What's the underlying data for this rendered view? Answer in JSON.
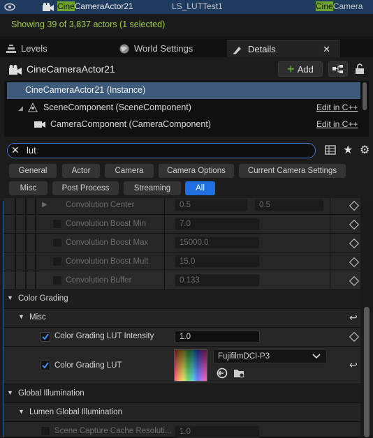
{
  "outliner": {
    "highlight": "Cine",
    "actor_suffix": "CameraActor21",
    "level": "LS_LUTTest1",
    "type_highlight": "Cine",
    "type_suffix": "Camera",
    "status": "Showing 39 of 3,837 actors (1 selected)"
  },
  "tabs": {
    "levels": "Levels",
    "world_settings": "World Settings",
    "details": "Details"
  },
  "details": {
    "title": "CineCameraActor21",
    "add_label": "Add",
    "components": [
      {
        "label": "CineCameraActor21 (Instance)",
        "edit": ""
      },
      {
        "label": "SceneComponent (SceneComponent)",
        "edit": "Edit in C++"
      },
      {
        "label": "CameraComponent (CameraComponent)",
        "edit": "Edit in C++"
      }
    ],
    "search_value": "lut",
    "filters": [
      "General",
      "Actor",
      "Camera",
      "Camera Options",
      "Current Camera Settings",
      "Misc",
      "Post Process",
      "Streaming",
      "All"
    ]
  },
  "properties": {
    "conv_center": {
      "label": "Convolution Center",
      "x": "0.5",
      "y": "0.5"
    },
    "conv_boost_min": {
      "label": "Convolution Boost Min",
      "value": "7.0"
    },
    "conv_boost_max": {
      "label": "Convolution Boost Max",
      "value": "15000.0"
    },
    "conv_boost_mult": {
      "label": "Convolution Boost Mult",
      "value": "15.0"
    },
    "conv_buffer": {
      "label": "Convolution Buffer",
      "value": "0.133"
    },
    "color_grading": "Color Grading",
    "misc": "Misc",
    "lut_intensity": {
      "label": "Color Grading LUT Intensity",
      "value": "1.0"
    },
    "lut": {
      "label": "Color Grading LUT",
      "asset": "FujifilmDCI-P3"
    },
    "global_illumination": "Global Illumination",
    "lumen_gi": "Lumen Global Illumination",
    "scene_capture": {
      "label": "Scene Capture Cache Resoluti...",
      "value": "1.0"
    }
  }
}
